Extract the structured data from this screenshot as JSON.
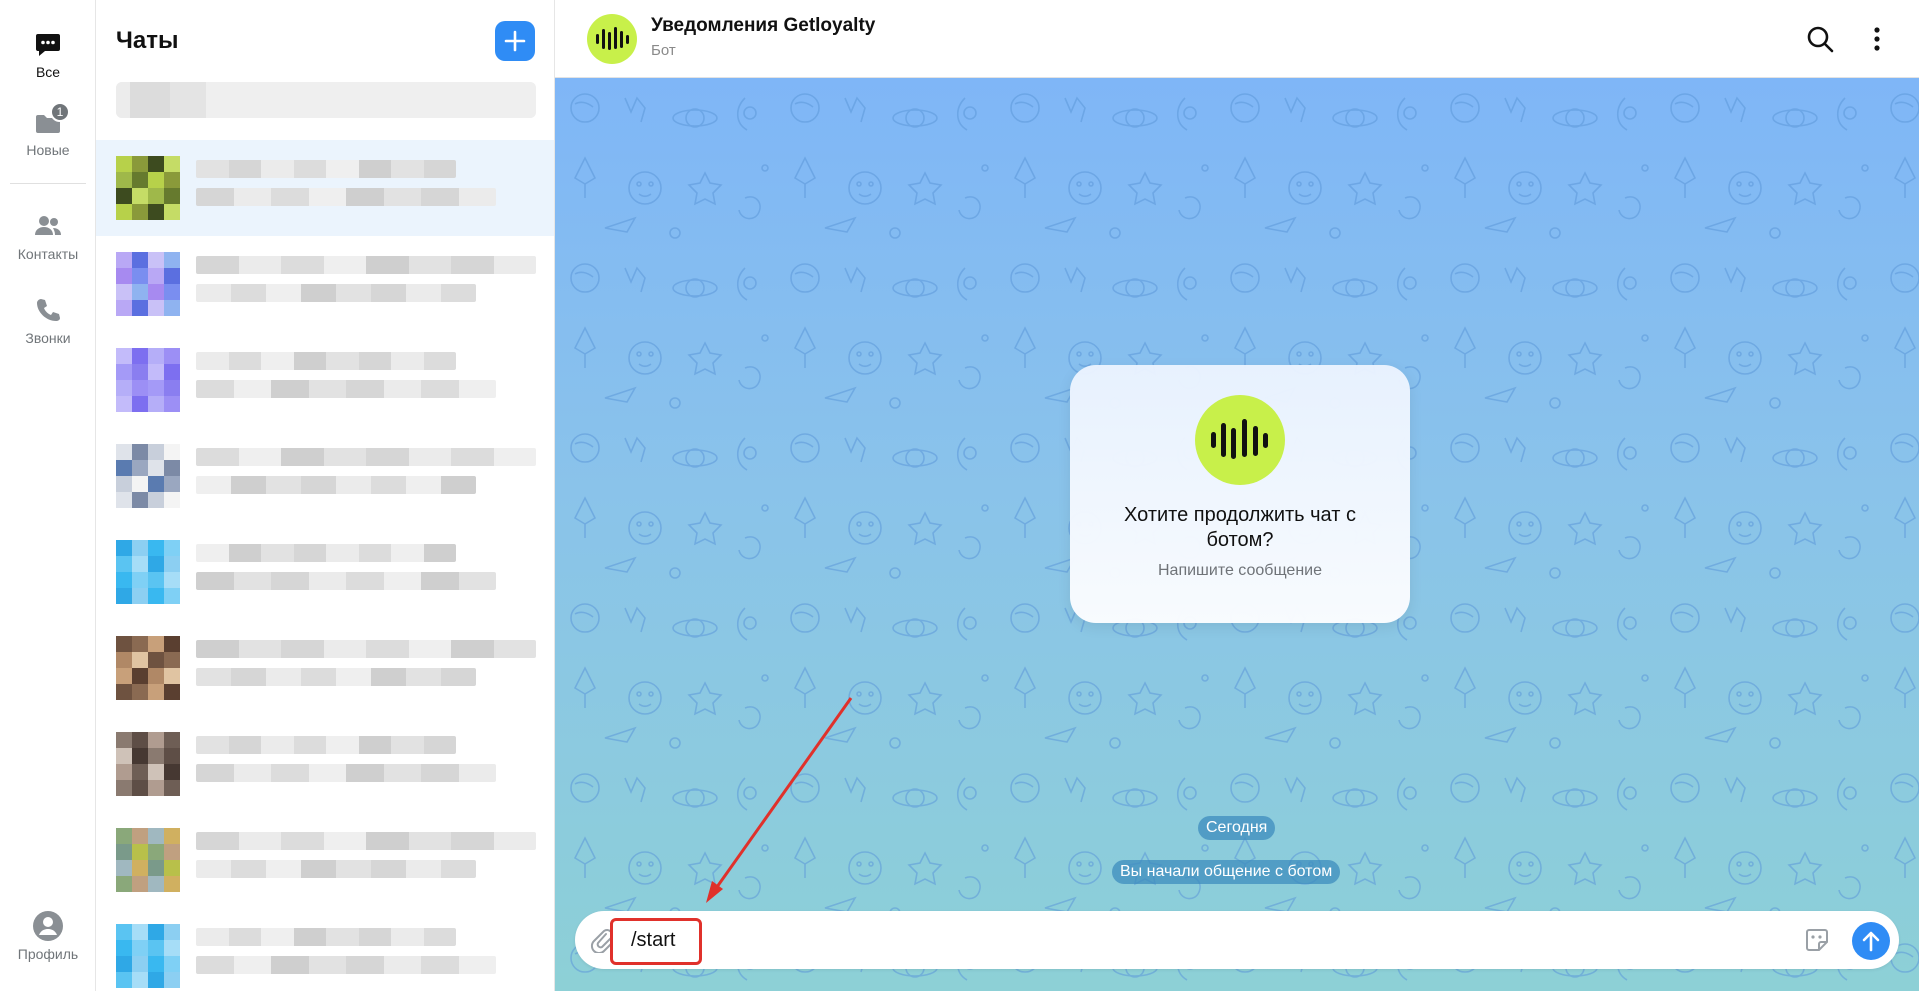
{
  "rail": {
    "items": [
      {
        "label": "Все",
        "icon": "chat-bubble-icon",
        "active": true
      },
      {
        "label": "Новые",
        "icon": "folder-icon",
        "badge": "1"
      },
      {
        "label": "Контакты",
        "icon": "contacts-icon"
      },
      {
        "label": "Звонки",
        "icon": "phone-icon"
      }
    ],
    "profile": {
      "label": "Профиль",
      "icon": "profile-icon"
    }
  },
  "list": {
    "title": "Чаты",
    "new_chat_icon": "plus-icon"
  },
  "chat": {
    "title": "Уведомления Getloyalty",
    "subtitle": "Бот",
    "bot_card": {
      "title": "Хотите продолжить чат с ботом?",
      "hint": "Напишите сообщение"
    },
    "date_pill": "Сегодня",
    "system_pill": "Вы начали общение с ботом",
    "composer": {
      "value": "/start"
    }
  },
  "colors": {
    "accent": "#2f8cf5",
    "bot_brand": "#c8f04a",
    "annotation": "#e0312b"
  }
}
